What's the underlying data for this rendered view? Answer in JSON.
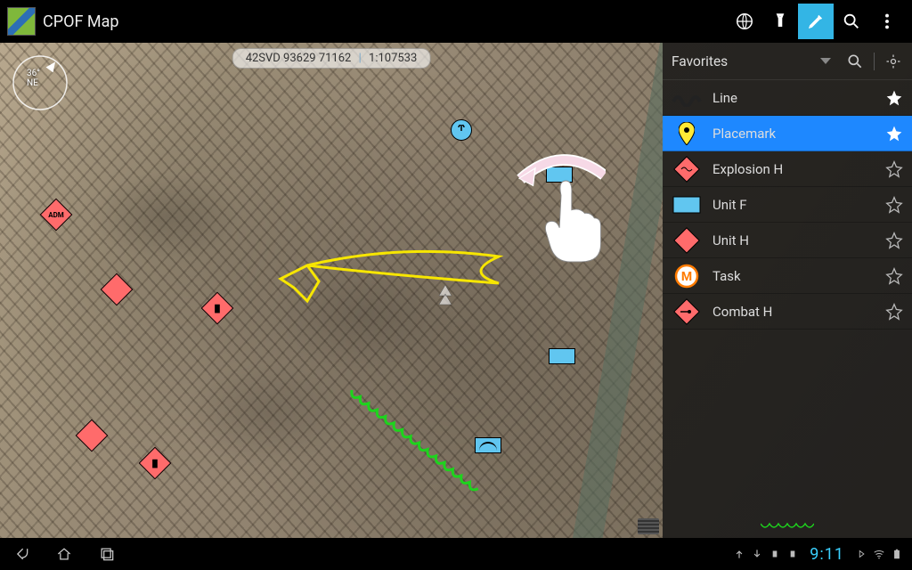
{
  "app_title": "CPOF Map",
  "compass": {
    "heading_deg": "36°",
    "heading_dir": "NE"
  },
  "coord": {
    "mgrs": "42SVD 93629 71162",
    "scale": "1:107533"
  },
  "topbar_tools": [
    {
      "id": "globe",
      "name": "globe-button"
    },
    {
      "id": "flashlight",
      "name": "flashlight-button"
    },
    {
      "id": "draw",
      "name": "draw-button",
      "selected": true
    },
    {
      "id": "search",
      "name": "search-button"
    },
    {
      "id": "overflow",
      "name": "overflow-button"
    }
  ],
  "sidebar": {
    "title": "Favorites",
    "items": [
      {
        "label": "Line",
        "icon": "line",
        "fav": true
      },
      {
        "label": "Placemark",
        "icon": "placemark",
        "fav": true,
        "selected": true
      },
      {
        "label": "Explosion H",
        "icon": "explosion-h",
        "fav": false
      },
      {
        "label": "Unit F",
        "icon": "unit-f",
        "fav": false
      },
      {
        "label": "Unit H",
        "icon": "unit-h",
        "fav": false
      },
      {
        "label": "Task",
        "icon": "task",
        "fav": false
      },
      {
        "label": "Combat H",
        "icon": "combat-h",
        "fav": false
      }
    ]
  },
  "statusbar": {
    "clock": "9:11"
  }
}
